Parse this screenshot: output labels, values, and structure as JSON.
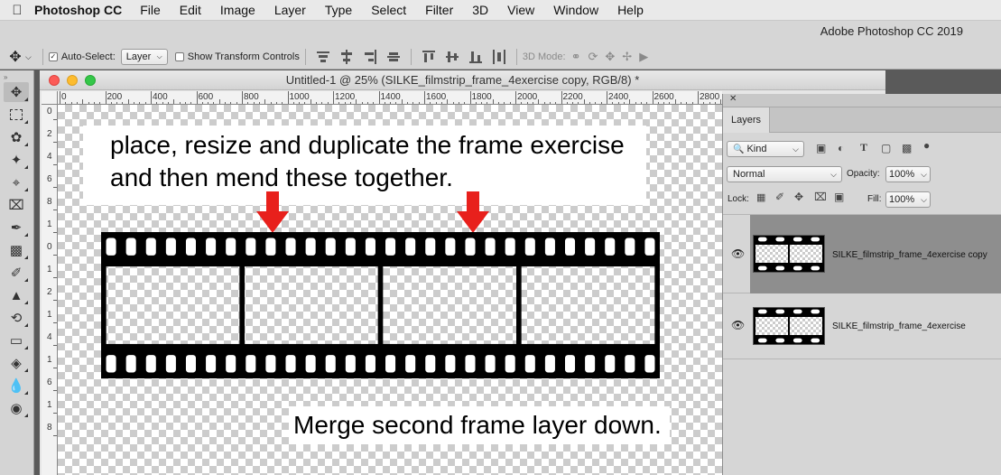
{
  "menubar": {
    "app_name": "Photoshop CC",
    "items": [
      "File",
      "Edit",
      "Image",
      "Layer",
      "Type",
      "Select",
      "Filter",
      "3D",
      "View",
      "Window",
      "Help"
    ]
  },
  "options_bar": {
    "app_title": "Adobe Photoshop CC 2019",
    "auto_select_label": "Auto-Select:",
    "auto_select_value": "Layer",
    "transform_controls_label": "Show Transform Controls",
    "mode_3d_label": "3D Mode:"
  },
  "document": {
    "title": "Untitled-1 @ 25% (SILKE_filmstrip_frame_4exercise copy, RGB/8) *",
    "ruler_h_ticks": [
      "0",
      "200",
      "400",
      "600",
      "800",
      "1000",
      "1200",
      "1400",
      "1600",
      "1800",
      "2000",
      "2200",
      "2400",
      "2600",
      "2800"
    ],
    "ruler_v_ticks": [
      "0",
      "2",
      "4",
      "6",
      "8",
      "1",
      "0",
      "1",
      "2",
      "1",
      "4",
      "1",
      "6",
      "1",
      "8"
    ]
  },
  "canvas": {
    "instruction_line1": "place, resize and duplicate the frame exercise",
    "instruction_line2": "and then mend these together.",
    "merge_note": "Merge second frame layer down."
  },
  "layers_panel": {
    "tab_label": "Layers",
    "filter_kind": "Kind",
    "blend_mode": "Normal",
    "opacity_label": "Opacity:",
    "opacity_value": "100%",
    "lock_label": "Lock:",
    "fill_label": "Fill:",
    "fill_value": "100%",
    "layers": [
      {
        "name": "SILKE_filmstrip_frame_4exercise copy",
        "selected": true
      },
      {
        "name": "SILKE_filmstrip_frame_4exercise",
        "selected": false
      }
    ]
  },
  "colors": {
    "arrow": "#e8201c",
    "selected_layer": "#8e8e8e",
    "canvas_checker": "#cccccc"
  }
}
